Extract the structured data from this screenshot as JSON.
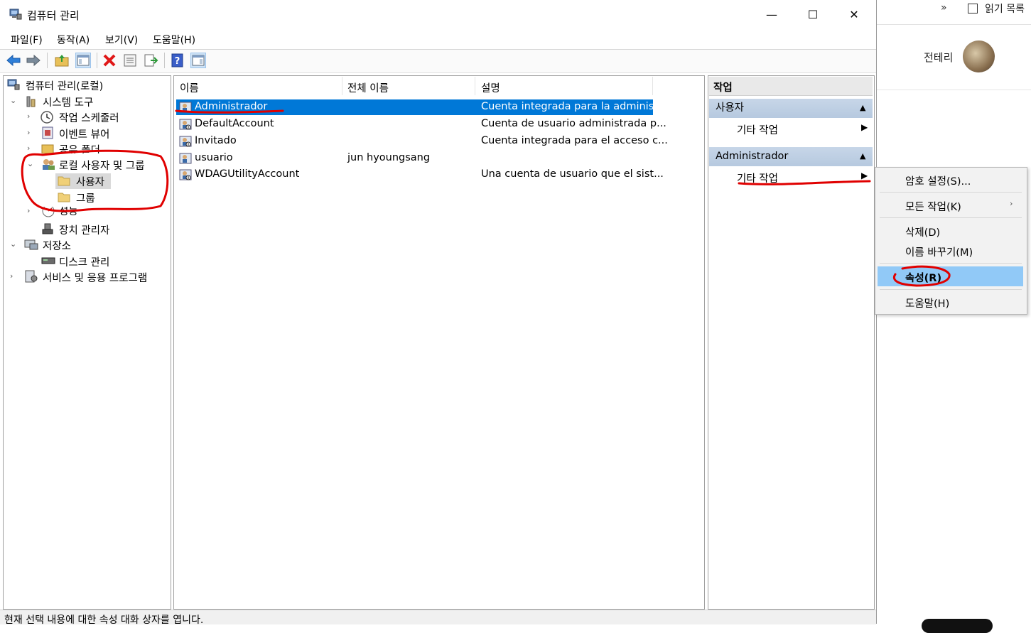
{
  "window": {
    "title": "컴퓨터 관리",
    "minimize_glyph": "—",
    "maximize_glyph": "☐",
    "close_glyph": "✕"
  },
  "menu": [
    "파일(F)",
    "동작(A)",
    "보기(V)",
    "도움말(H)"
  ],
  "toolbar": {
    "icons": [
      "back-icon",
      "forward-icon",
      "up-folder-icon",
      "show-hide-tree-icon",
      "delete-icon",
      "properties-icon",
      "export-list-icon",
      "help-icon",
      "action-pane-icon"
    ]
  },
  "tree": {
    "root": "컴퓨터 관리(로컬)",
    "system_tools": "시스템 도구",
    "task_scheduler": "작업 스케줄러",
    "event_viewer": "이벤트 뷰어",
    "shared_folders": "공유 폴더",
    "local_users_groups": "로컬 사용자 및 그룹",
    "users": "사용자",
    "groups": "그룹",
    "performance": "성능",
    "device_manager": "장치 관리자",
    "storage": "저장소",
    "disk_management": "디스크 관리",
    "services_apps": "서비스 및 응용 프로그램"
  },
  "list": {
    "columns": [
      "이름",
      "전체 이름",
      "설명"
    ],
    "rows": [
      {
        "name": "Administrador",
        "full_name": "",
        "description": "Cuenta integrada para la administ...",
        "selected": true
      },
      {
        "name": "DefaultAccount",
        "full_name": "",
        "description": "Cuenta de usuario administrada p..."
      },
      {
        "name": "Invitado",
        "full_name": "",
        "description": "Cuenta integrada para el acceso c..."
      },
      {
        "name": "usuario",
        "full_name": "jun hyoungsang",
        "description": ""
      },
      {
        "name": "WDAGUtilityAccount",
        "full_name": "",
        "description": "Una cuenta de usuario que el sist..."
      }
    ]
  },
  "actions": {
    "header": "작업",
    "section1": "사용자",
    "section1_item": "기타 작업",
    "section2": "Administrador",
    "section2_item": "기타 작업"
  },
  "context_menu": {
    "set_password": "암호 설정(S)...",
    "all_tasks": "모든 작업(K)",
    "delete": "삭제(D)",
    "rename": "이름 바꾸기(M)",
    "properties": "속성(R)",
    "help": "도움말(H)"
  },
  "status": "현재 선택 내용에 대한 속성 대화 상자를 엽니다.",
  "background": {
    "chevron": "»",
    "reading_list": "읽기 목록",
    "profile_name": "전테리"
  },
  "colors": {
    "selection": "#0078d7",
    "menu_highlight": "#91c9f7",
    "action_header": "#bccce0",
    "annotation_red": "#e00000"
  }
}
